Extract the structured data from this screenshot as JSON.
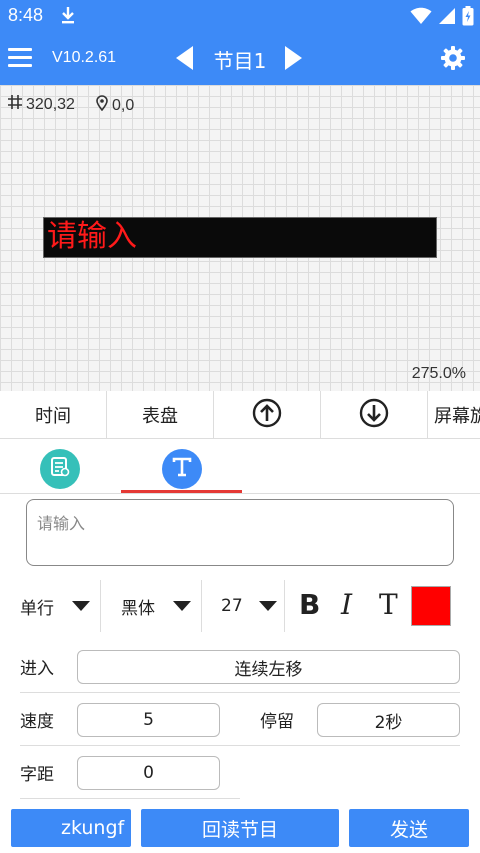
{
  "status_bar": {
    "time": "8:48"
  },
  "app_bar": {
    "version": "V10.2.61",
    "title": "节目1"
  },
  "canvas": {
    "size": "320,32",
    "position": "0,0",
    "led_text": "请输入",
    "zoom": "275.0%"
  },
  "toolbar": {
    "time": "时间",
    "dial": "表盘",
    "screen": "屏幕旋"
  },
  "editor": {
    "placeholder": "请输入",
    "line_mode": "单行",
    "font": "黑体",
    "font_size": "27",
    "bold": "B",
    "italic": "I",
    "text_style": "T",
    "color": "#ff0000"
  },
  "fields": {
    "enter_label": "进入",
    "enter_value": "连续左移",
    "speed_label": "速度",
    "speed_value": "5",
    "stay_label": "停留",
    "stay_value": "2秒",
    "spacing_label": "字距",
    "spacing_value": "0"
  },
  "bottom": {
    "marquee": "zkungf",
    "readback": "回读节目",
    "send": "发送"
  },
  "colors": {
    "primary": "#3d8af7",
    "accent": "#e53935",
    "teal": "#36c0b9"
  },
  "icons": [
    "download-icon",
    "wifi-icon",
    "signal-icon",
    "battery-icon",
    "menu-icon",
    "prev-arrow-icon",
    "next-arrow-icon",
    "gear-icon",
    "grid-icon",
    "location-icon",
    "up-arrow-circle-icon",
    "down-arrow-circle-icon",
    "document-settings-icon",
    "text-icon",
    "dropdown-arrow-icon"
  ]
}
